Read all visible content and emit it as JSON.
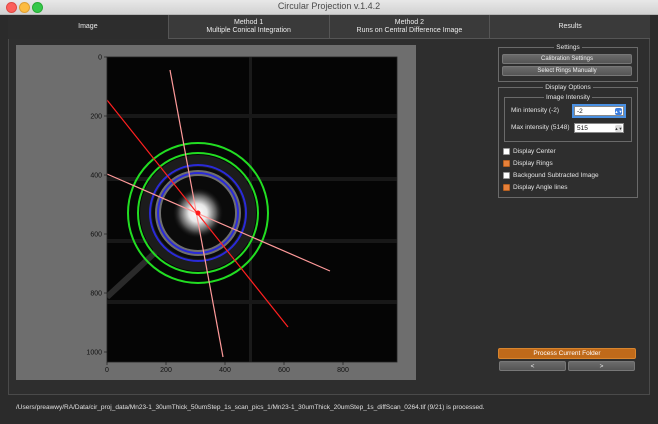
{
  "window": {
    "title": "Circular Projection v.1.4.2"
  },
  "tabs": [
    {
      "label": "Image"
    },
    {
      "label": "Method 1\nMultiple Conical Integration"
    },
    {
      "label": "Method 2\nRuns on Central Difference Image"
    },
    {
      "label": "Results"
    }
  ],
  "plot": {
    "x_ticks": [
      "0",
      "200",
      "400",
      "600",
      "800"
    ],
    "y_ticks": [
      "0",
      "200",
      "400",
      "600",
      "800",
      "1000"
    ]
  },
  "settings": {
    "legend": "Settings",
    "calibration_label": "Calibration Settings",
    "select_rings_label": "Select Rings Manually"
  },
  "display_options": {
    "legend": "Display Options",
    "image_intensity": {
      "legend": "Image Intensity",
      "min_label": "Min intensity (-2)",
      "min_value": "-2",
      "max_label": "Max intensity (5148)",
      "max_value": "515"
    },
    "checkboxes": [
      {
        "label": "Display Center",
        "checked": false
      },
      {
        "label": "Display Rings",
        "checked": true
      },
      {
        "label": "Backgound Subtracted Image",
        "checked": false
      },
      {
        "label": "Display Angle lines",
        "checked": true
      }
    ]
  },
  "actions": {
    "process_label": "Process Current Folder",
    "prev_label": "<",
    "next_label": ">"
  },
  "status": {
    "message": "/Users/preawwy/RA/Data/cir_proj_data/Mn23-1_30umThick_50umStep_1s_scan_pics_1/Mn23-1_30umThick_20umStep_1s_diffScan_0264.tif (9/21) is processed."
  },
  "colors": {
    "accent_orange": "#c06a1a",
    "ring_green": "#22dd22",
    "ring_blue": "#2222cc",
    "line_red": "#ff2020",
    "line_pink": "#ff9a9a"
  }
}
